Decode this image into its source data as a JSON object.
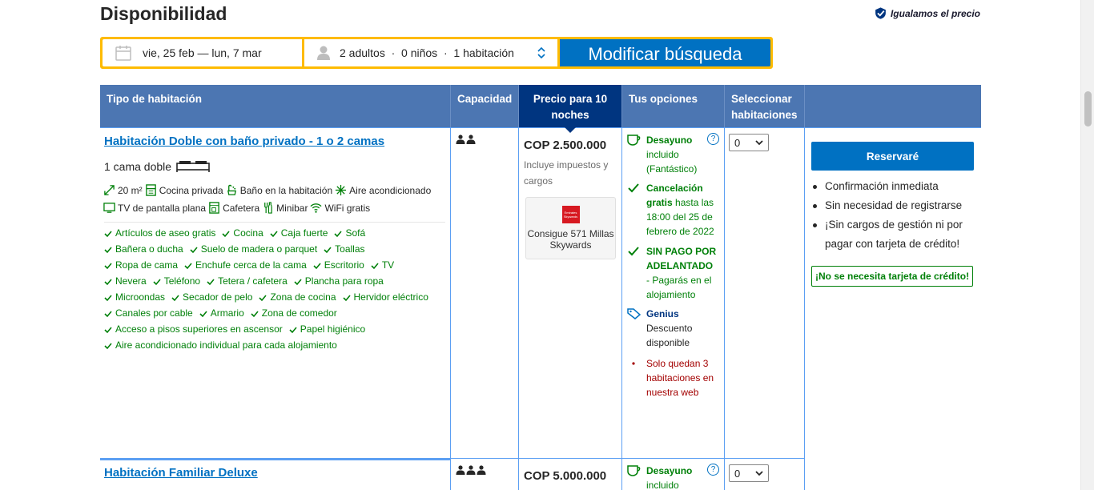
{
  "header": {
    "title": "Disponibilidad",
    "price_match": "Igualamos el precio"
  },
  "search": {
    "dates": "vie, 25 feb — lun, 7 mar",
    "guests": "2 adultos  ·  0 niños  ·  1 habitación",
    "button": "Modificar búsqueda"
  },
  "table": {
    "headers": {
      "type": "Tipo de habitación",
      "capacity": "Capacidad",
      "price": "Precio para 10 noches",
      "options": "Tus opciones",
      "select": "Seleccionar habitaciones"
    },
    "rooms": [
      {
        "name": "Habitación Doble con baño privado - 1 o 2 camas",
        "bed": "1 cama doble",
        "facilities": [
          "20 m²",
          "Cocina privada",
          "Baño en la habitación",
          "Aire acondicionado",
          "TV de pantalla plana",
          "Cafetera",
          "Minibar",
          "WiFi gratis"
        ],
        "amenities": [
          "Artículos de aseo gratis",
          "Cocina",
          "Caja fuerte",
          "Sofá",
          "Bañera o ducha",
          "Suelo de madera o parquet",
          "Toallas",
          "Ropa de cama",
          "Enchufe cerca de la cama",
          "Escritorio",
          "TV",
          "Nevera",
          "Teléfono",
          "Tetera / cafetera",
          "Plancha para ropa",
          "Microondas",
          "Secador de pelo",
          "Zona de cocina",
          "Hervidor eléctrico",
          "Canales por cable",
          "Armario",
          "Zona de comedor",
          "Acceso a pisos superiores en ascensor",
          "Papel higiénico",
          "Aire acondicionado individual para cada alojamiento"
        ],
        "price": "COP 2.500.000",
        "price_note": "Incluye impuestos y cargos",
        "skywards": "Consigue 571 Millas Skywards",
        "skywards_logo": "Emirates Skywards",
        "options": {
          "breakfast_bold": "Desayuno",
          "breakfast_rest": "incluido (Fantástico)",
          "cancel_bold": "Cancelación gratis",
          "cancel_rest": "hasta las 18:00 del 25 de febrero de 2022",
          "nopay_bold": "SIN PAGO POR ADELANTADO",
          "nopay_rest": "- Pagarás en el alojamiento",
          "genius_bold": "Genius",
          "genius_rest": "Descuento disponible",
          "alert": "Solo quedan 3 habitaciones en nuestra web"
        },
        "qty": "0"
      },
      {
        "name": "Habitación Familiar Deluxe",
        "price": "COP 5.000.000",
        "breakfast_bold": "Desayuno",
        "breakfast_rest": "incluido",
        "qty": "0"
      }
    ],
    "reserve": {
      "button": "Reservaré",
      "perks": [
        "Confirmación inmediata",
        "Sin necesidad de registrarse",
        "¡Sin cargos de gestión ni por pagar con tarjeta de crédito!"
      ],
      "no_card": "¡No se necesita tarjeta de crédito!"
    }
  },
  "colors": {
    "header_blue": "#4c76b2",
    "price_header": "#003580",
    "link_blue": "#0071c2",
    "green": "#008009",
    "alert_red": "#a30000",
    "search_yellow": "#febb02"
  }
}
